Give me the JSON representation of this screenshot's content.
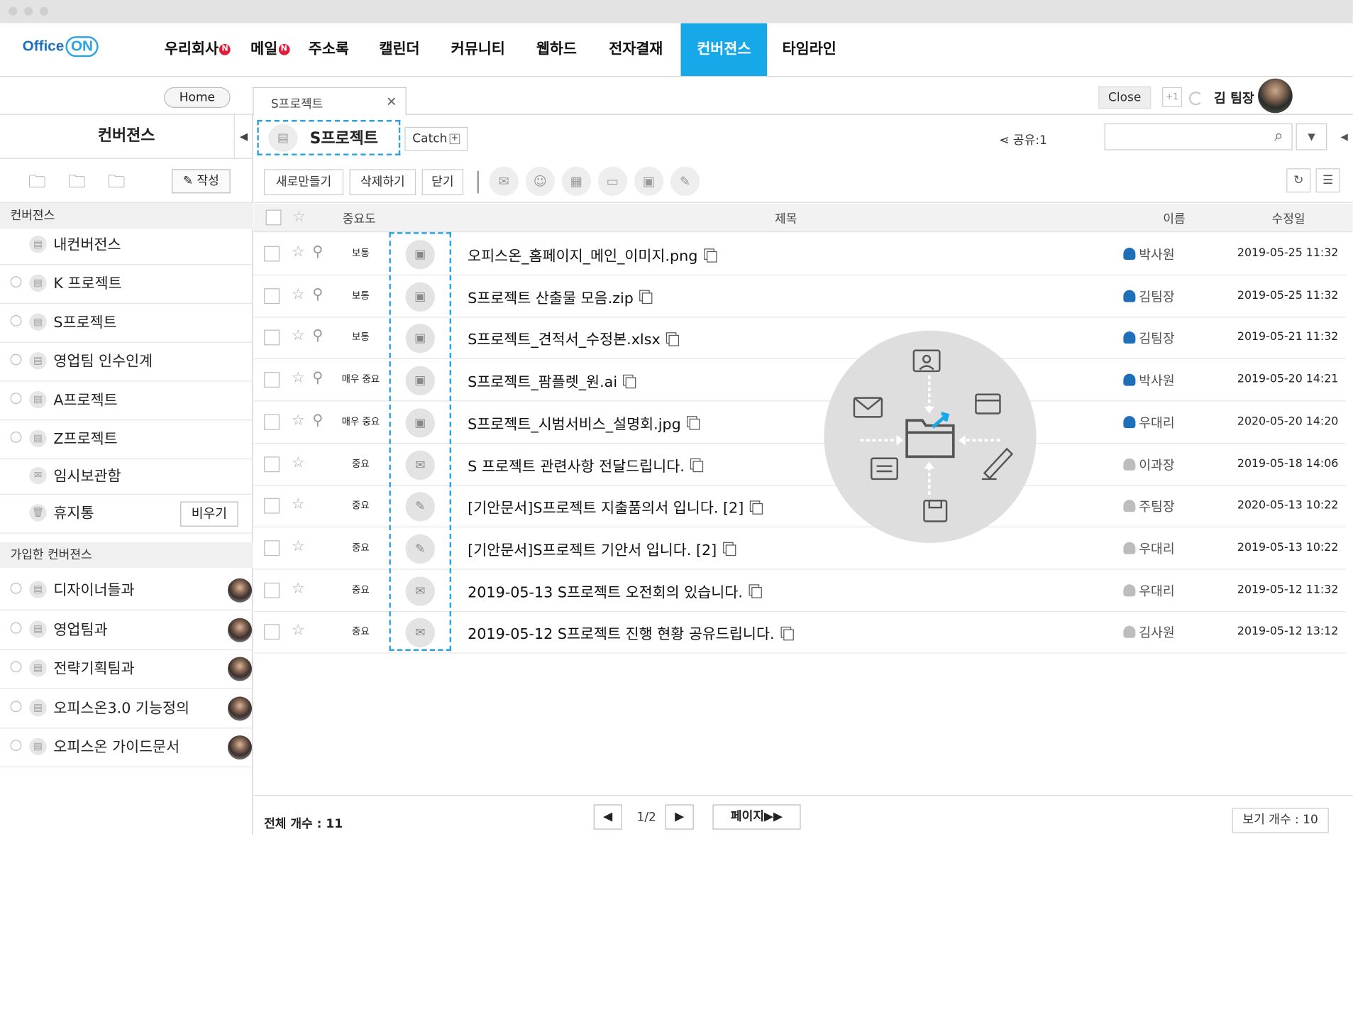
{
  "logo": {
    "text": "Office",
    "on": "ON"
  },
  "nav": [
    {
      "label": "우리회사",
      "badge": "N",
      "active": false
    },
    {
      "label": "메일",
      "badge": "N",
      "active": false
    },
    {
      "label": "주소록",
      "badge": "",
      "active": false
    },
    {
      "label": "캘린더",
      "badge": "",
      "active": false
    },
    {
      "label": "커뮤니티",
      "badge": "",
      "active": false
    },
    {
      "label": "웹하드",
      "badge": "",
      "active": false
    },
    {
      "label": "전자결재",
      "badge": "",
      "active": false
    },
    {
      "label": "컨버젼스",
      "badge": "",
      "active": true
    },
    {
      "label": "타임라인",
      "badge": "",
      "active": false
    }
  ],
  "tabs": {
    "home": "Home",
    "doc": "S프로젝트",
    "close": "Close",
    "plus_one": "+1",
    "user": "김 팀장"
  },
  "sidebar": {
    "title": "컨버젼스",
    "write": "작성",
    "section1": "컨버젼스",
    "items": [
      {
        "label": "내컨버전스",
        "radio": false,
        "icon": "folder"
      },
      {
        "label": "K 프로젝트",
        "radio": true,
        "icon": "folder"
      },
      {
        "label": "S프로젝트",
        "radio": true,
        "icon": "folder"
      },
      {
        "label": "영업팀 인수인계",
        "radio": true,
        "icon": "folder"
      },
      {
        "label": "A프로젝트",
        "radio": true,
        "icon": "folder"
      },
      {
        "label": "Z프로젝트",
        "radio": true,
        "icon": "folder"
      },
      {
        "label": "임시보관함",
        "radio": false,
        "icon": "mail"
      },
      {
        "label": "휴지통",
        "radio": false,
        "icon": "trash"
      }
    ],
    "empty_button": "비우기",
    "section2": "가입한 컨버젼스",
    "joined": [
      {
        "label": "디자이너들과"
      },
      {
        "label": "영업팀과"
      },
      {
        "label": "전략기획팀과"
      },
      {
        "label": "오피스온3.0 기능정의"
      },
      {
        "label": "오피스온 가이드문서"
      }
    ]
  },
  "project": {
    "title": "S프로젝트",
    "catch": "Catch",
    "share": "공유:1",
    "search_placeholder": ""
  },
  "toolbar": {
    "new": "새로만들기",
    "delete": "삭제하기",
    "close": "닫기"
  },
  "table": {
    "headers": {
      "importance": "중요도",
      "title": "제목",
      "name": "이름",
      "modified": "수정일"
    },
    "rows": [
      {
        "clip": true,
        "importance": "보통",
        "type": "save",
        "title": "오피스온_홈페이지_메인_이미지.png",
        "name": "박사원",
        "active": true,
        "date": "2019-05-25 11:32"
      },
      {
        "clip": true,
        "importance": "보통",
        "type": "save",
        "title": "S프로젝트 산출물 모음.zip",
        "name": "김팀장",
        "active": true,
        "date": "2019-05-25 11:32"
      },
      {
        "clip": true,
        "importance": "보통",
        "type": "save",
        "title": "S프로젝트_견적서_수정본.xlsx",
        "name": "김팀장",
        "active": true,
        "date": "2019-05-21 11:32"
      },
      {
        "clip": true,
        "importance": "매우 중요",
        "type": "save",
        "title": "S프로젝트_팜플렛_원.ai",
        "name": "박사원",
        "active": true,
        "date": "2019-05-20 14:21"
      },
      {
        "clip": true,
        "importance": "매우 중요",
        "type": "save",
        "title": "S프로젝트_시범서비스_설명회.jpg",
        "name": "우대리",
        "active": true,
        "date": "2020-05-20 14:20"
      },
      {
        "clip": false,
        "importance": "중요",
        "type": "mail",
        "title": "S 프로젝트 관련사항 전달드립니다.",
        "name": "이과장",
        "active": false,
        "date": "2019-05-18 14:06"
      },
      {
        "clip": false,
        "importance": "중요",
        "type": "sign",
        "title": "[기안문서]S프로젝트 지출품의서 입니다. [2]",
        "name": "주팀장",
        "active": false,
        "date": "2020-05-13 10:22"
      },
      {
        "clip": false,
        "importance": "중요",
        "type": "sign",
        "title": "[기안문서]S프로젝트 기안서 입니다. [2]",
        "name": "우대리",
        "active": false,
        "date": "2019-05-13 10:22"
      },
      {
        "clip": false,
        "importance": "중요",
        "type": "mail",
        "title": "2019-05-13 S프로젝트 오전회의 있습니다.",
        "name": "우대리",
        "active": false,
        "date": "2019-05-12 11:32"
      },
      {
        "clip": false,
        "importance": "중요",
        "type": "mail",
        "title": "2019-05-12 S프로젝트 진행 현황 공유드립니다.",
        "name": "김사원",
        "active": false,
        "date": "2019-05-12 13:12"
      }
    ]
  },
  "footer": {
    "total": "전체 개수 : 11",
    "page": "1/2",
    "page_button": "페이지▶▶",
    "view_count": "보기 개수 : 10"
  },
  "colors": {
    "accent": "#16a8e8",
    "badge": "#e01e3c",
    "dashed": "#29a3e0",
    "person_active": "#1f6fb8",
    "person_inactive": "#bdbdbd"
  }
}
